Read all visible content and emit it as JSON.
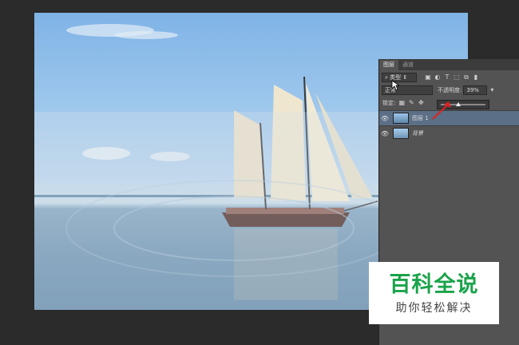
{
  "colors": {
    "app_background": "#2b2b2b",
    "panel_background": "#535353",
    "selected_layer": "#5b6f86",
    "watermark_green": "#1aa34a",
    "arrow_red": "#e02020"
  },
  "panel": {
    "tabs": [
      {
        "label": "图层",
        "active": true
      },
      {
        "label": "通道",
        "active": false
      }
    ],
    "filter": {
      "label": "类型",
      "icon": "search-icon"
    },
    "blend_mode": "正常",
    "opacity_label": "不透明度:",
    "opacity_value": "39%",
    "opacity_level": 0.39,
    "lock_label": "锁定:",
    "layers": [
      {
        "name": "图层 1",
        "selected": true,
        "visible": true
      },
      {
        "name": "背景",
        "selected": false,
        "visible": true
      }
    ]
  },
  "watermark": {
    "title": "百科全说",
    "subtitle": "助你轻松解决"
  }
}
